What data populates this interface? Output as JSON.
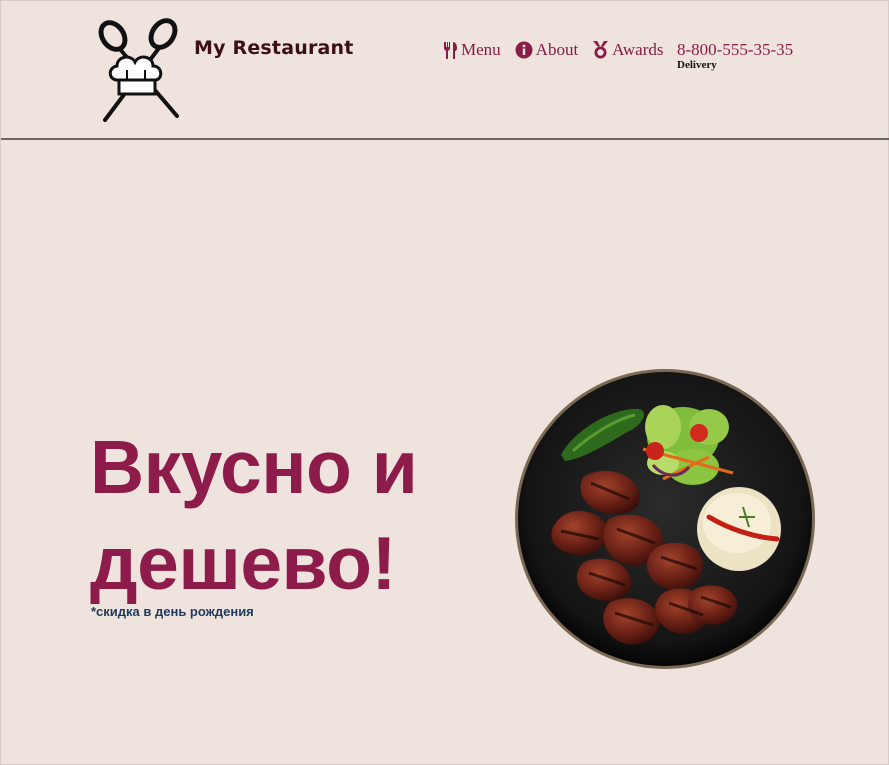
{
  "header": {
    "brand": "My Restaurant",
    "nav": [
      {
        "label": "Menu",
        "icon": "utensils-icon"
      },
      {
        "label": "About",
        "icon": "info-circle-icon"
      },
      {
        "label": "Awards",
        "icon": "medal-icon"
      }
    ],
    "phone": "8-800-555-35-35",
    "phone_caption": "Delivery"
  },
  "hero": {
    "headline_line1": "Вкусно и",
    "headline_line2": "дешево!",
    "note": "*скидка в день рождения",
    "image": "grilled-meat-plate"
  },
  "colors": {
    "background": "#efe3de",
    "accent": "#8e1c4b",
    "brand_text": "#3c0f12",
    "note_text": "#1f3a5a"
  }
}
